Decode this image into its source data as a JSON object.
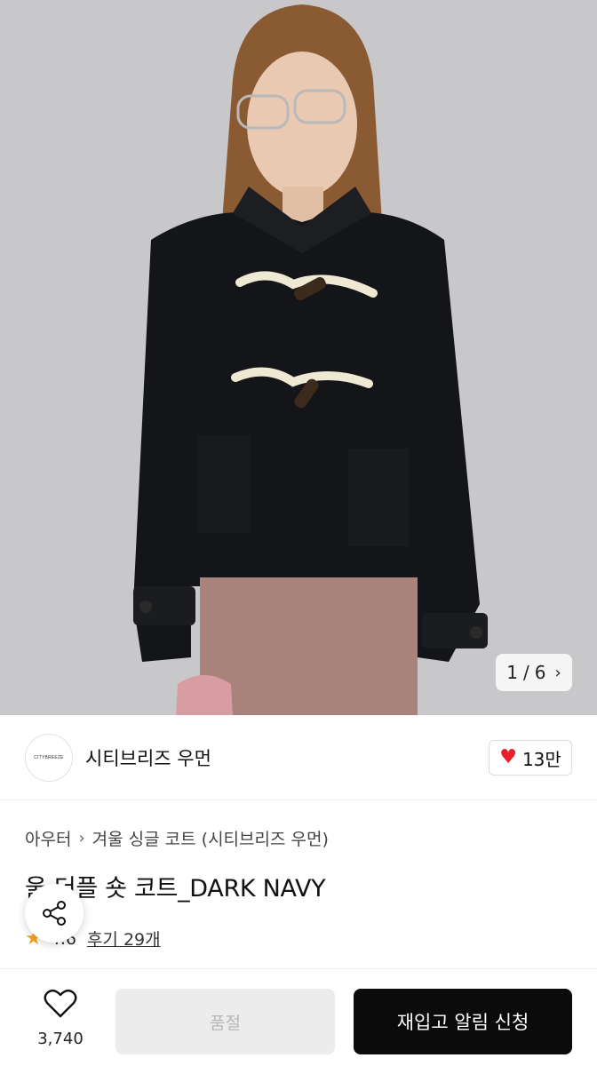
{
  "gallery": {
    "current": "1",
    "separator": "/",
    "total": "6",
    "image_subject": "model wearing dark navy wool duffle short coat"
  },
  "brand": {
    "logo_text": "CITYBREEZE",
    "name": "시티브리즈 우먼",
    "like_count": "13만"
  },
  "breadcrumb": {
    "items": [
      "아우터",
      "겨울 싱글 코트 (시티브리즈 우먼)"
    ]
  },
  "product": {
    "title": "울 더플 숏 코트_DARK NAVY",
    "rating": "4.6",
    "reviews": "후기 29개"
  },
  "bottom_bar": {
    "wish_count": "3,740",
    "soldout_label": "품절",
    "restock_label": "재입고 알림 신청"
  },
  "colors": {
    "accent_red": "#e8202a",
    "star": "#f5a623",
    "primary_button": "#0b0b0b",
    "disabled_button": "#ececec"
  }
}
